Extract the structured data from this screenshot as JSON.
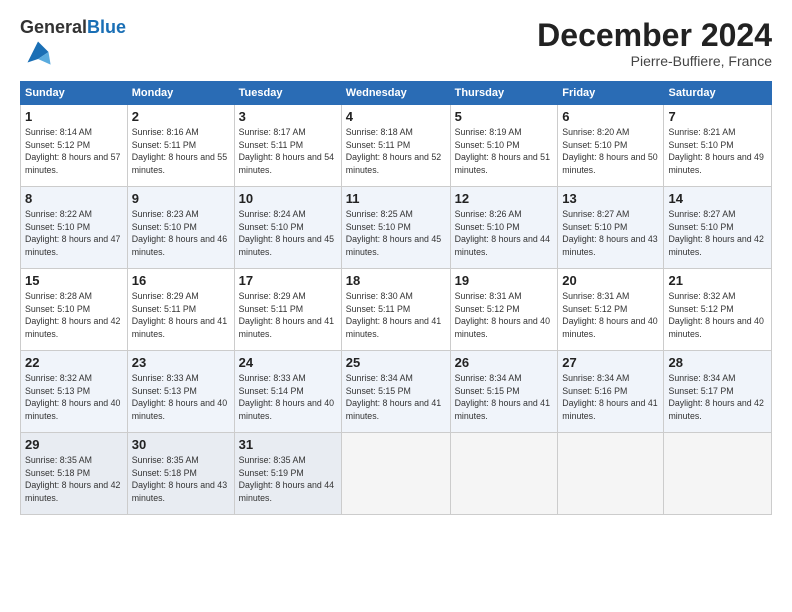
{
  "header": {
    "logo_general": "General",
    "logo_blue": "Blue",
    "month": "December 2024",
    "location": "Pierre-Buffiere, France"
  },
  "days_of_week": [
    "Sunday",
    "Monday",
    "Tuesday",
    "Wednesday",
    "Thursday",
    "Friday",
    "Saturday"
  ],
  "weeks": [
    [
      {
        "day": "1",
        "sunrise": "8:14 AM",
        "sunset": "5:12 PM",
        "daylight": "8 hours and 57 minutes."
      },
      {
        "day": "2",
        "sunrise": "8:16 AM",
        "sunset": "5:11 PM",
        "daylight": "8 hours and 55 minutes."
      },
      {
        "day": "3",
        "sunrise": "8:17 AM",
        "sunset": "5:11 PM",
        "daylight": "8 hours and 54 minutes."
      },
      {
        "day": "4",
        "sunrise": "8:18 AM",
        "sunset": "5:11 PM",
        "daylight": "8 hours and 52 minutes."
      },
      {
        "day": "5",
        "sunrise": "8:19 AM",
        "sunset": "5:10 PM",
        "daylight": "8 hours and 51 minutes."
      },
      {
        "day": "6",
        "sunrise": "8:20 AM",
        "sunset": "5:10 PM",
        "daylight": "8 hours and 50 minutes."
      },
      {
        "day": "7",
        "sunrise": "8:21 AM",
        "sunset": "5:10 PM",
        "daylight": "8 hours and 49 minutes."
      }
    ],
    [
      {
        "day": "8",
        "sunrise": "8:22 AM",
        "sunset": "5:10 PM",
        "daylight": "8 hours and 47 minutes."
      },
      {
        "day": "9",
        "sunrise": "8:23 AM",
        "sunset": "5:10 PM",
        "daylight": "8 hours and 46 minutes."
      },
      {
        "day": "10",
        "sunrise": "8:24 AM",
        "sunset": "5:10 PM",
        "daylight": "8 hours and 45 minutes."
      },
      {
        "day": "11",
        "sunrise": "8:25 AM",
        "sunset": "5:10 PM",
        "daylight": "8 hours and 45 minutes."
      },
      {
        "day": "12",
        "sunrise": "8:26 AM",
        "sunset": "5:10 PM",
        "daylight": "8 hours and 44 minutes."
      },
      {
        "day": "13",
        "sunrise": "8:27 AM",
        "sunset": "5:10 PM",
        "daylight": "8 hours and 43 minutes."
      },
      {
        "day": "14",
        "sunrise": "8:27 AM",
        "sunset": "5:10 PM",
        "daylight": "8 hours and 42 minutes."
      }
    ],
    [
      {
        "day": "15",
        "sunrise": "8:28 AM",
        "sunset": "5:10 PM",
        "daylight": "8 hours and 42 minutes."
      },
      {
        "day": "16",
        "sunrise": "8:29 AM",
        "sunset": "5:11 PM",
        "daylight": "8 hours and 41 minutes."
      },
      {
        "day": "17",
        "sunrise": "8:29 AM",
        "sunset": "5:11 PM",
        "daylight": "8 hours and 41 minutes."
      },
      {
        "day": "18",
        "sunrise": "8:30 AM",
        "sunset": "5:11 PM",
        "daylight": "8 hours and 41 minutes."
      },
      {
        "day": "19",
        "sunrise": "8:31 AM",
        "sunset": "5:12 PM",
        "daylight": "8 hours and 40 minutes."
      },
      {
        "day": "20",
        "sunrise": "8:31 AM",
        "sunset": "5:12 PM",
        "daylight": "8 hours and 40 minutes."
      },
      {
        "day": "21",
        "sunrise": "8:32 AM",
        "sunset": "5:12 PM",
        "daylight": "8 hours and 40 minutes."
      }
    ],
    [
      {
        "day": "22",
        "sunrise": "8:32 AM",
        "sunset": "5:13 PM",
        "daylight": "8 hours and 40 minutes."
      },
      {
        "day": "23",
        "sunrise": "8:33 AM",
        "sunset": "5:13 PM",
        "daylight": "8 hours and 40 minutes."
      },
      {
        "day": "24",
        "sunrise": "8:33 AM",
        "sunset": "5:14 PM",
        "daylight": "8 hours and 40 minutes."
      },
      {
        "day": "25",
        "sunrise": "8:34 AM",
        "sunset": "5:15 PM",
        "daylight": "8 hours and 41 minutes."
      },
      {
        "day": "26",
        "sunrise": "8:34 AM",
        "sunset": "5:15 PM",
        "daylight": "8 hours and 41 minutes."
      },
      {
        "day": "27",
        "sunrise": "8:34 AM",
        "sunset": "5:16 PM",
        "daylight": "8 hours and 41 minutes."
      },
      {
        "day": "28",
        "sunrise": "8:34 AM",
        "sunset": "5:17 PM",
        "daylight": "8 hours and 42 minutes."
      }
    ],
    [
      {
        "day": "29",
        "sunrise": "8:35 AM",
        "sunset": "5:18 PM",
        "daylight": "8 hours and 42 minutes."
      },
      {
        "day": "30",
        "sunrise": "8:35 AM",
        "sunset": "5:18 PM",
        "daylight": "8 hours and 43 minutes."
      },
      {
        "day": "31",
        "sunrise": "8:35 AM",
        "sunset": "5:19 PM",
        "daylight": "8 hours and 44 minutes."
      },
      null,
      null,
      null,
      null
    ]
  ]
}
